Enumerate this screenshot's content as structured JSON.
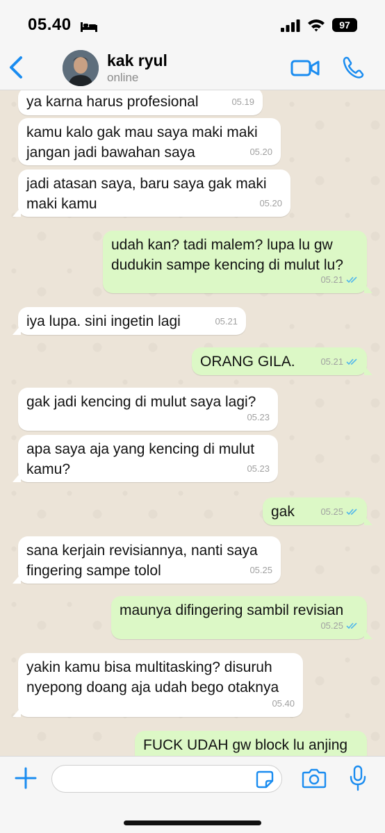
{
  "status_bar": {
    "time": "05.40",
    "battery": "97"
  },
  "header": {
    "contact_name": "kak ryul",
    "contact_status": "online"
  },
  "messages": [
    {
      "dir": "in",
      "text": "ya karna harus profesional",
      "time": "05.19"
    },
    {
      "dir": "in",
      "text": "kamu kalo gak mau saya maki maki\njangan jadi bawahan saya",
      "time": "05.20"
    },
    {
      "dir": "in",
      "text": "jadi atasan saya, baru saya gak maki\nmaki kamu",
      "time": "05.20"
    },
    {
      "dir": "out",
      "text": "udah kan? tadi malem? lupa lu gw\ndudukin sampe kencing di mulut lu?",
      "time": "05.21",
      "read": true
    },
    {
      "dir": "in",
      "text": "iya lupa. sini ingetin lagi",
      "time": "05.21"
    },
    {
      "dir": "out",
      "text": "ORANG GILA.",
      "time": "05.21",
      "read": true
    },
    {
      "dir": "in",
      "text": "gak jadi kencing di mulut saya lagi?",
      "time": "05.23"
    },
    {
      "dir": "in",
      "text": "apa saya aja yang kencing di mulut\nkamu?",
      "time": "05.23"
    },
    {
      "dir": "out",
      "text": "gak",
      "time": "05.25",
      "read": true
    },
    {
      "dir": "in",
      "text": "sana kerjain revisiannya, nanti saya\nfingering sampe tolol",
      "time": "05.25"
    },
    {
      "dir": "out",
      "text": "maunya difingering sambil revisian",
      "time": "05.25",
      "read": true
    },
    {
      "dir": "in",
      "text": "yakin kamu bisa multitasking? disuruh\nnyepong doang aja udah bego otaknya",
      "time": "05.40"
    },
    {
      "dir": "out",
      "text": "FUCK UDAH gw block lu anjing",
      "time": "",
      "read": false
    }
  ],
  "composer": {
    "placeholder": ""
  },
  "colors": {
    "accent": "#1a8cf0",
    "outgoing_bubble": "#dcf8c6",
    "incoming_bubble": "#ffffff",
    "read_ticks": "#4fb6ec"
  }
}
